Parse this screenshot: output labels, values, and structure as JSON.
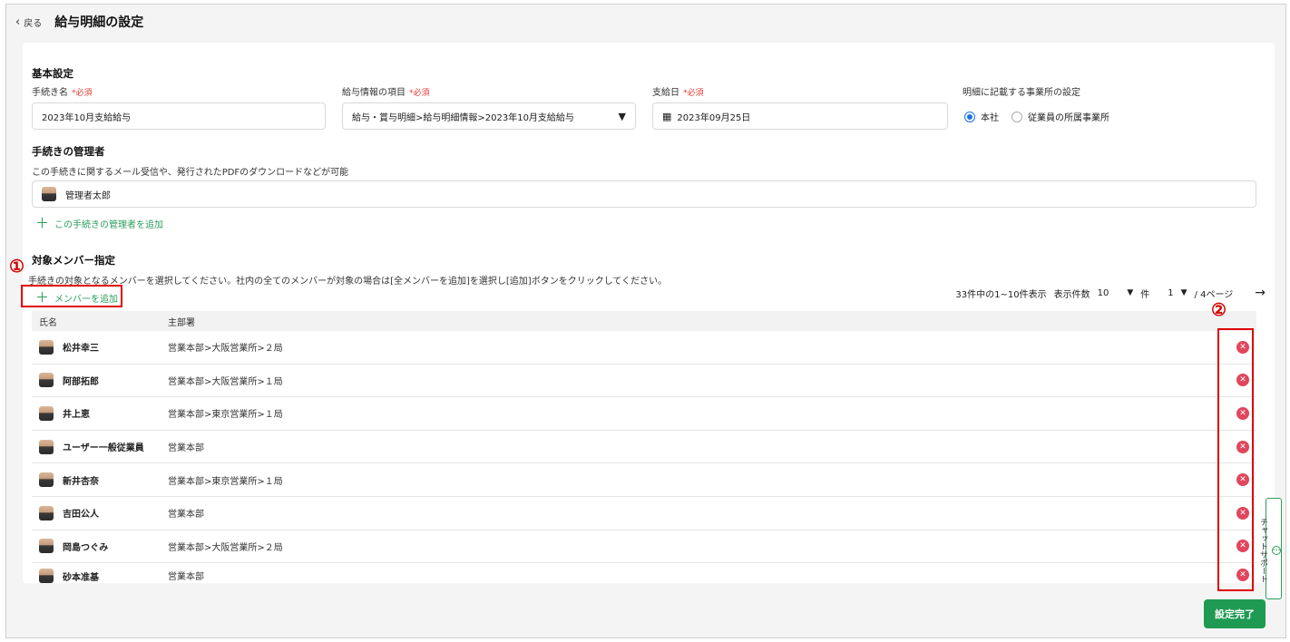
{
  "header": {
    "back_label": "戻る",
    "title": "給与明細の設定"
  },
  "basic": {
    "section_title": "基本設定",
    "procedure_name": {
      "label": "手続き名",
      "required": "*必須",
      "value": "2023年10月支給給与"
    },
    "salary_item": {
      "label": "給与情報の項目",
      "required": "*必須",
      "value": "給与・賞与明細>給与明細情報>2023年10月支給給与"
    },
    "pay_date": {
      "label": "支給日",
      "required": "*必須",
      "value": "2023年09月25日"
    },
    "office": {
      "label": "明細に記載する事業所の設定",
      "option1": "本社",
      "option2": "従業員の所属事業所",
      "selected": "本社"
    }
  },
  "admins": {
    "section_title": "手続きの管理者",
    "description": "この手続きに関するメール受信や、発行されたPDFのダウンロードなどが可能",
    "current": "管理者太郎",
    "add_label": "この手続きの管理者を追加"
  },
  "members": {
    "section_title": "対象メンバー指定",
    "description": "手続きの対象となるメンバーを選択してください。社内の全てのメンバーが対象の場合は[全メンバーを追加]を選択し[追加]ボタンをクリックしてください。",
    "add_label": "メンバーを追加",
    "pager": {
      "summary": "33件中の1~10件表示",
      "per_page_label": "表示件数",
      "per_page": "10",
      "unit": "件",
      "page": "1",
      "page_suffix": "/ 4ページ"
    },
    "columns": {
      "name": "氏名",
      "dept": "主部署"
    },
    "rows": [
      {
        "name": "松井幸三",
        "dept": "営業本部>大阪営業所>２局"
      },
      {
        "name": "阿部拓郎",
        "dept": "営業本部>大阪営業所>１局"
      },
      {
        "name": "井上恵",
        "dept": "営業本部>東京営業所>１局"
      },
      {
        "name": "ユーザー一般従業員",
        "dept": "営業本部"
      },
      {
        "name": "新井杏奈",
        "dept": "営業本部>東京営業所>１局"
      },
      {
        "name": "吉田公人",
        "dept": "営業本部"
      },
      {
        "name": "岡島つぐみ",
        "dept": "営業本部>大阪営業所>２局"
      },
      {
        "name": "砂本准基",
        "dept": "営業本部"
      }
    ]
  },
  "annotations": {
    "one": "①",
    "two": "②"
  },
  "chat_support": "チャットサポート",
  "done_button": "設定完了",
  "colors": {
    "accent_green": "#1f9a52",
    "remove_red": "#e0465c",
    "highlight_red": "#e00000"
  }
}
